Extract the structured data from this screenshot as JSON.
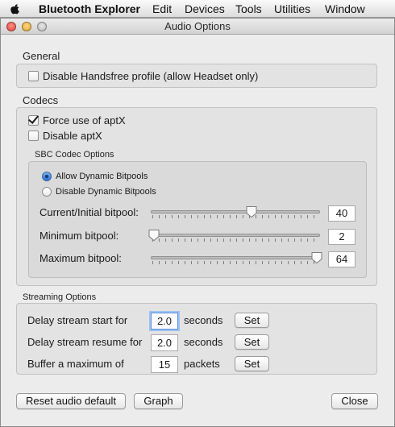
{
  "menubar": {
    "app_name": "Bluetooth Explorer",
    "items": [
      "Edit",
      "Devices",
      "Tools",
      "Utilities",
      "Window"
    ]
  },
  "window": {
    "title": "Audio Options"
  },
  "general": {
    "label": "General",
    "disable_handsfree": {
      "label": "Disable Handsfree profile (allow Headset only)",
      "checked": false
    }
  },
  "codecs": {
    "label": "Codecs",
    "force_aptx": {
      "label": "Force use of aptX",
      "checked": true
    },
    "disable_aptx": {
      "label": "Disable aptX",
      "checked": false
    },
    "sbc": {
      "label": "SBC Codec Options",
      "allow_dynamic": {
        "label": "Allow Dynamic Bitpools",
        "selected": true
      },
      "disable_dynamic": {
        "label": "Disable Dynamic Bitpools",
        "selected": false
      },
      "current_bitpool": {
        "label": "Current/Initial bitpool:",
        "value": "40",
        "level": 0.6
      },
      "minimum_bitpool": {
        "label": "Minimum bitpool:",
        "value": "2",
        "level": 0.0
      },
      "maximum_bitpool": {
        "label": "Maximum bitpool:",
        "value": "64",
        "level": 1.0
      }
    }
  },
  "streaming": {
    "label": "Streaming Options",
    "delay_start": {
      "label": "Delay stream start for",
      "value": "2.0",
      "unit": "seconds",
      "button": "Set"
    },
    "delay_resume": {
      "label": "Delay stream resume for",
      "value": "2.0",
      "unit": "seconds",
      "button": "Set"
    },
    "buffer_max": {
      "label": "Buffer a maximum of",
      "value": "15",
      "unit": "packets",
      "button": "Set"
    }
  },
  "footer": {
    "reset_label": "Reset audio default",
    "graph_label": "Graph",
    "close_label": "Close"
  },
  "colors": {
    "window_bg": "#ececec",
    "focus_ring": "#9cc2f2",
    "radio_selected": "#2f6fd1"
  },
  "icons": {
    "apple": "apple-icon",
    "close": "close-window-icon",
    "minimize": "minimize-window-icon",
    "zoom": "zoom-window-icon",
    "checkmark": "checkmark-icon",
    "slider_thumb": "slider-thumb-icon"
  }
}
